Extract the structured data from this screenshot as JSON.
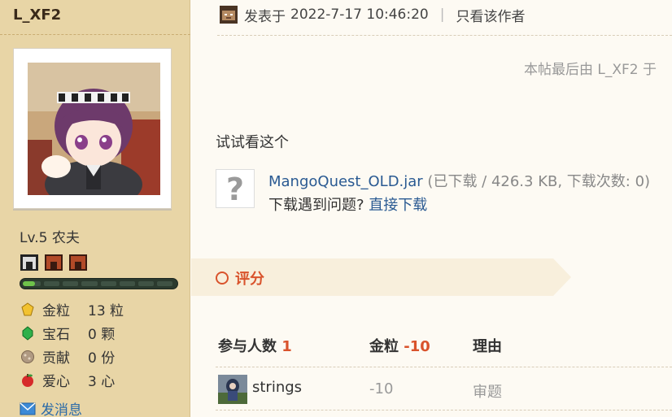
{
  "user": {
    "name": "L_XF2",
    "level": "Lv.5 农夫",
    "stats": [
      {
        "icon": "gold-nugget-icon",
        "label": "金粒",
        "value": "13 粒",
        "color": "#f2c230"
      },
      {
        "icon": "emerald-icon",
        "label": "宝石",
        "value": "0 颗",
        "color": "#2fb04a"
      },
      {
        "icon": "contribution-icon",
        "label": "贡献",
        "value": "0 份",
        "color": "#b09a82"
      },
      {
        "icon": "apple-icon",
        "label": "爱心",
        "value": "3 心",
        "color": "#d62a2a"
      }
    ],
    "exp_progress": 0.08,
    "send_message": "发消息"
  },
  "post": {
    "posted_prefix": "发表于",
    "posted_time": "2022-7-17 10:46:20",
    "separator": "|",
    "author_only": "只看该作者",
    "last_edit": "本帖最后由 L_XF2 于",
    "text": "试试看这个",
    "attachment": {
      "filename": "MangoQuest_OLD.jar",
      "meta": " (已下载 / 426.3 KB, 下载次数: 0)",
      "problem": "下载遇到问题? ",
      "direct_link": "直接下载"
    }
  },
  "rating": {
    "title": "评分",
    "participants_label": "参与人数",
    "participants_count": "1",
    "gold_label": "金粒",
    "gold_total": "-10",
    "reason_label": "理由",
    "rows": [
      {
        "name": "strings",
        "score": "-10",
        "reason": "审题"
      }
    ]
  },
  "colors": {
    "sidebar_bg": "#e8d5a6",
    "accent": "#d9532c",
    "link": "#2a5a92"
  }
}
